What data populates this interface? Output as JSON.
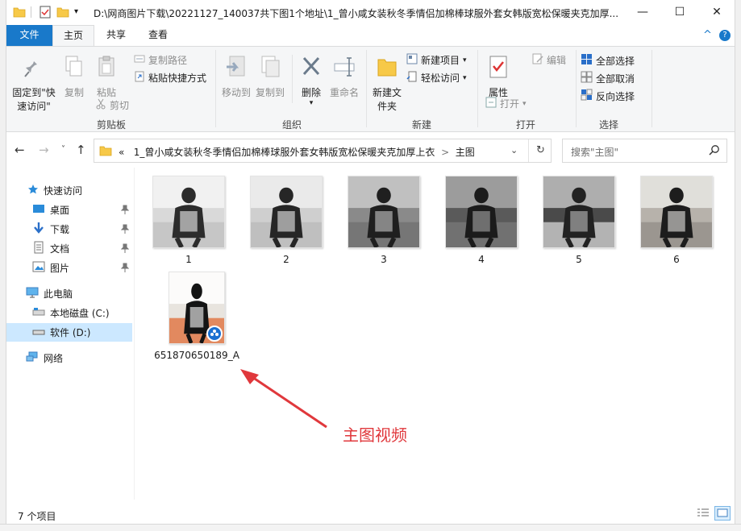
{
  "window": {
    "title": "D:\\网商图片下载\\20221127_140037共下图1个地址\\1_曾小咸女装秋冬季情侣加棉棒球服外套女韩版宽松保暖夹克加厚...",
    "minimize_glyph": "—",
    "maximize_glyph": "☐",
    "close_glyph": "✕"
  },
  "ribbon_tabs": {
    "file": "文件",
    "home": "主页",
    "share": "共享",
    "view": "查看",
    "collapse": "^",
    "help": "?"
  },
  "ribbon": {
    "clipboard": {
      "pin": "固定到\"快速访问\"",
      "copy": "复制",
      "paste": "粘贴",
      "copy_path": "复制路径",
      "paste_shortcut": "粘贴快捷方式",
      "cut": "剪切",
      "label": "剪贴板"
    },
    "organize": {
      "move_to": "移动到",
      "copy_to": "复制到",
      "delete": "删除",
      "rename": "重命名",
      "label": "组织"
    },
    "new": {
      "new_folder": "新建文件夹",
      "new_item": "新建项目",
      "easy_access": "轻松访问",
      "label": "新建"
    },
    "open": {
      "properties": "属性",
      "open": "打开",
      "edit": "编辑",
      "label": "打开"
    },
    "select": {
      "select_all": "全部选择",
      "select_none": "全部取消",
      "invert": "反向选择",
      "label": "选择"
    }
  },
  "address": {
    "overflow": "«",
    "path_segment": "1_曾小咸女装秋冬季情侣加棉棒球服外套女韩版宽松保暖夹克加厚上衣",
    "current": "主图",
    "separator": ">",
    "search_placeholder": "搜索\"主图\""
  },
  "nav_pane": {
    "quick_access": "快速访问",
    "desktop": "桌面",
    "downloads": "下载",
    "documents": "文档",
    "pictures": "图片",
    "this_pc": "此电脑",
    "local_c": "本地磁盘 (C:)",
    "soft_d": "软件 (D:)",
    "network": "网络"
  },
  "files": [
    {
      "name": "1",
      "palette": [
        "#d9d9d9",
        "#f4f4f4",
        "#2c2c2c",
        "#bdbdbd"
      ]
    },
    {
      "name": "2",
      "palette": [
        "#cfcfcf",
        "#efefef",
        "#262626",
        "#b8b8b8"
      ]
    },
    {
      "name": "3",
      "palette": [
        "#8a8a8a",
        "#c9c9c9",
        "#1f1f1f",
        "#6e6e6e"
      ]
    },
    {
      "name": "4",
      "palette": [
        "#5a5a5a",
        "#a8a8a8",
        "#1b1b1b",
        "#7a7a7a"
      ]
    },
    {
      "name": "5",
      "palette": [
        "#4a4a4a",
        "#bfbfbf",
        "#222222",
        "#e0e0e0"
      ]
    },
    {
      "name": "6",
      "palette": [
        "#b7b2ab",
        "#e8e6e2",
        "#1d1d1d",
        "#8e8a84"
      ]
    },
    {
      "name": "651870650189_A",
      "palette": [
        "#e8e4de",
        "#ffffff",
        "#141414",
        "#e0622a"
      ],
      "video": true
    }
  ],
  "annotation": {
    "text": "主图视频",
    "color": "#e0383c"
  },
  "status": {
    "item_count": "7 个项目"
  },
  "colors": {
    "accent": "#1979ca",
    "selection": "#cce8ff",
    "ribbon_bg": "#f5f6f7"
  }
}
